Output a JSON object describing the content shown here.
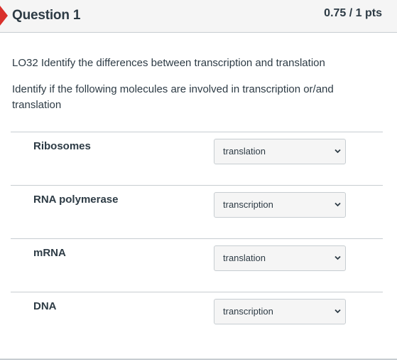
{
  "header": {
    "title": "Question 1",
    "points": "0.75 / 1 pts"
  },
  "body": {
    "learning_objective": "LO32 Identify the differences between transcription and translation",
    "prompt": "Identify if the following molecules are involved in transcription or/and translation"
  },
  "matches": [
    {
      "label": "Ribosomes",
      "selected": "translation",
      "icon": "chevron-down-icon"
    },
    {
      "label": "RNA polymerase",
      "selected": "transcription",
      "icon": "chevron-down-icon"
    },
    {
      "label": "mRNA",
      "selected": "translation",
      "icon": "chevron-down-icon"
    },
    {
      "label": "DNA",
      "selected": "transcription",
      "icon": "chevron-down-icon"
    }
  ],
  "colors": {
    "flag": "#d9302b",
    "header_bg": "#f5f5f5",
    "text": "#2d3b45",
    "border": "#c7cdd1"
  }
}
